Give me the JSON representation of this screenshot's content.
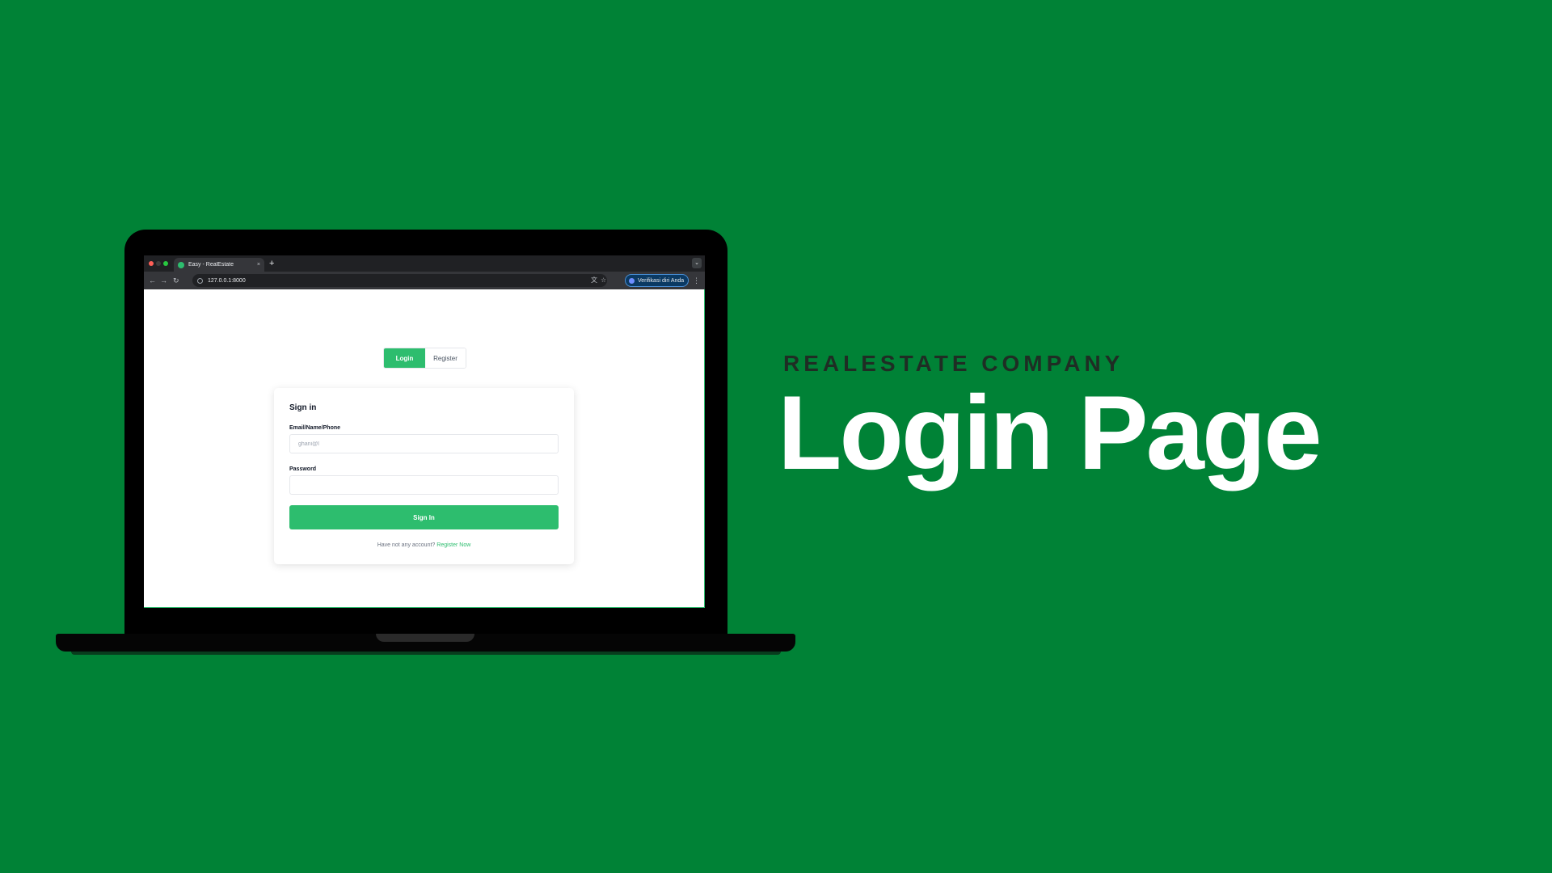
{
  "browser": {
    "tab_title": "Easy - RealEstate",
    "tab_close": "×",
    "new_tab": "+",
    "tab_menu": "⌄",
    "url": "127.0.0.1:8000",
    "back": "←",
    "forward": "→",
    "reload": "↻",
    "translate_icon": "文",
    "bookmark_icon": "☆",
    "profile_label": "Verifikasi diri Anda",
    "menu_icon": "⋮"
  },
  "segmented": {
    "login": "Login",
    "register": "Register"
  },
  "signin_card": {
    "title": "Sign in",
    "email_label": "Email/Name/Phone",
    "email_value": "ghani@l",
    "password_label": "Password",
    "password_value": "",
    "submit": "Sign In",
    "footer_text": "Have not any account?",
    "footer_link": "Register Now"
  },
  "hero": {
    "eyebrow": "REALESTATE COMPANY",
    "headline": "Login Page"
  },
  "colors": {
    "background": "#008236",
    "accent": "#2dbd6e",
    "eyebrow": "#1f2d24"
  }
}
